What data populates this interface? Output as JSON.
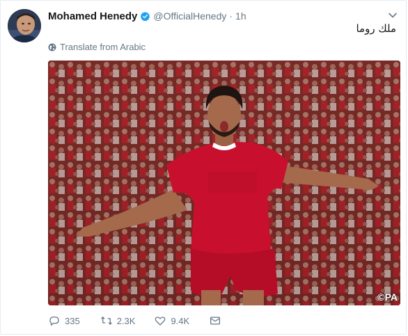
{
  "tweet": {
    "author_name": "Mohamed Henedy",
    "handle": "@OfficialHenedy",
    "separator": "·",
    "time": "1h",
    "text": "ملك روما",
    "translate_label": "Translate from Arabic",
    "media_credit": "©PA",
    "verified": true
  },
  "actions": {
    "replies": "335",
    "retweets": "2.3K",
    "likes": "9.4K"
  },
  "colors": {
    "verified_blue": "#1da1f2",
    "muted_text": "#657786",
    "kit_red": "#c8102e"
  },
  "icons": [
    "verified-badge-icon",
    "chevron-down-icon",
    "globe-icon",
    "reply-icon",
    "retweet-icon",
    "like-icon",
    "message-icon"
  ]
}
